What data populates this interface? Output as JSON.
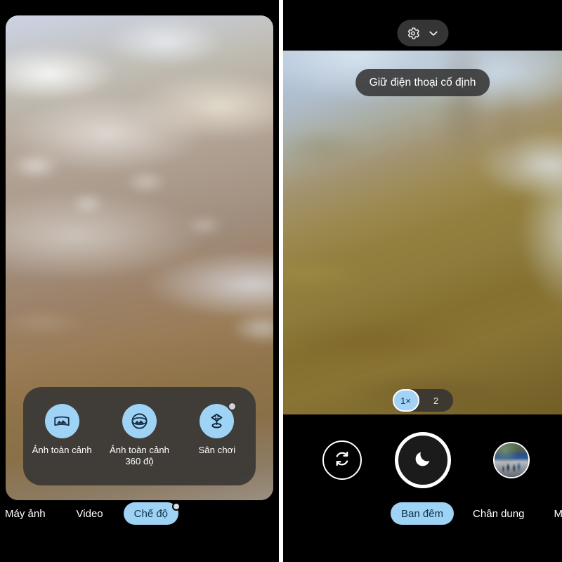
{
  "app": {
    "name": "Camera",
    "accent_blue": "#9fd3f5",
    "sheet_bg": "#3a3836",
    "panel_bg": "#000000"
  },
  "left_phone": {
    "name": "mode-picker-screen",
    "mode_sheet": {
      "items": [
        {
          "label": "Ảnh toàn cảnh",
          "icon": "panorama-icon",
          "is_new": false
        },
        {
          "label": "Ảnh toàn cảnh\n360 độ",
          "icon": "photo-sphere-icon",
          "is_new": false
        },
        {
          "label": "Sân chơi",
          "icon": "playground-ar-icon",
          "is_new": true
        }
      ]
    },
    "tabs": [
      {
        "label": "Máy ảnh",
        "active": false,
        "has_dot": false
      },
      {
        "label": "Video",
        "active": false,
        "has_dot": false
      },
      {
        "label": "Chế độ",
        "active": true,
        "has_dot": true
      }
    ]
  },
  "right_phone": {
    "name": "night-sight-screen",
    "top_bar": {
      "settings_icon": "gear-icon",
      "expand_icon": "chevron-down-icon"
    },
    "hint_toast": "Giữ điện thoại cố định",
    "focus_reticle": {
      "icon": "focus-exposure-crosshair-icon",
      "color": "#d4b24a"
    },
    "zoom_toggle": {
      "options": [
        {
          "label": "1×",
          "active": true
        },
        {
          "label": "2",
          "active": false
        }
      ]
    },
    "controls": {
      "flip_icon": "camera-flip-icon",
      "shutter_icon": "moon-night-sight-icon",
      "thumbnail_icon": "gallery-thumbnail"
    },
    "tabs": [
      {
        "label": "Ban đêm",
        "active": true,
        "has_dot": false
      },
      {
        "label": "Chân dung",
        "active": false,
        "has_dot": false
      },
      {
        "label": "Máy",
        "active": false,
        "has_dot": false
      }
    ]
  }
}
